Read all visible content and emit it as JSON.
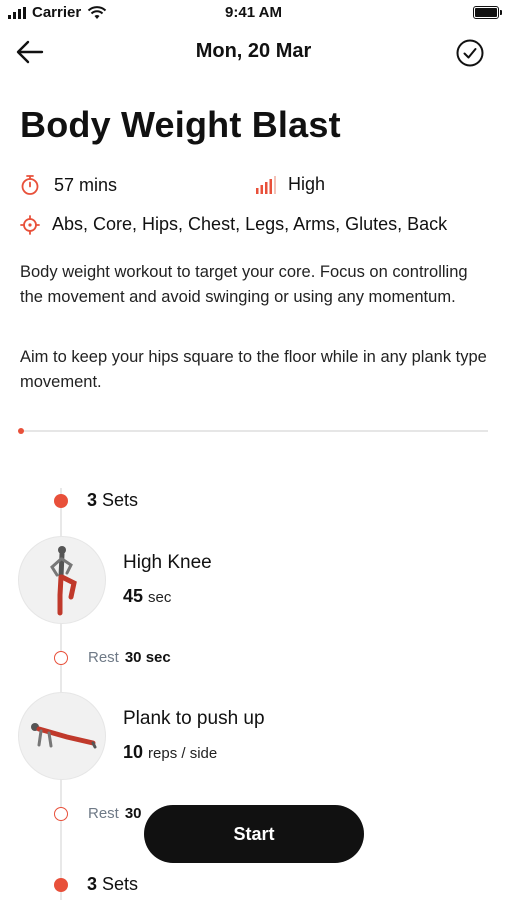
{
  "status_bar": {
    "carrier": "Carrier",
    "time": "9:41 AM"
  },
  "nav": {
    "title": "Mon, 20 Mar",
    "back_icon": "arrow-left-icon",
    "done_icon": "check-circle-icon"
  },
  "workout": {
    "title": "Body Weight Blast",
    "duration": "57 mins",
    "intensity": "High",
    "muscles": "Abs, Core, Hips, Chest, Legs, Arms, Glutes, Back",
    "description_1": "Body weight workout to target your core. Focus on controlling the movement and avoid swinging or using any momentum.",
    "description_2": "Aim to keep your hips square to the floor while in any plank type movement."
  },
  "blocks": [
    {
      "sets_count": "3",
      "sets_word": "Sets",
      "exercises": [
        {
          "name": "High Knee",
          "amount": "45",
          "unit": "sec"
        },
        {
          "name": "Plank to push up",
          "amount": "10",
          "unit": "reps / side"
        }
      ],
      "rests": [
        {
          "label": "Rest",
          "value": "30 sec"
        },
        {
          "label": "Rest",
          "value": "30"
        }
      ]
    },
    {
      "sets_count": "3",
      "sets_word": "Sets"
    }
  ],
  "actions": {
    "start_label": "Start"
  },
  "colors": {
    "accent": "#e8503a",
    "button": "#111111"
  }
}
